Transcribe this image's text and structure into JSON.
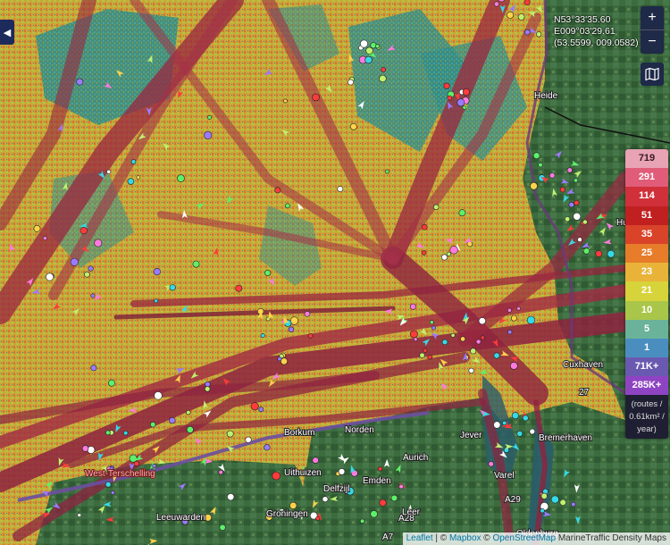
{
  "coords": {
    "lat": "N53°33'35.60",
    "lon": "E009°03'29.61",
    "decimal": "(53.5599, 009.0582)"
  },
  "controls": {
    "zoom_in": "+",
    "zoom_out": "−",
    "side_toggle": "◀",
    "layers_icon": "map-layers-icon"
  },
  "legend": {
    "values": [
      "719",
      "291",
      "114",
      "51",
      "35",
      "25",
      "23",
      "21",
      "10",
      "5",
      "1",
      "71K+",
      "285K+"
    ],
    "colors": [
      "#e8a3b4",
      "#e05c78",
      "#d0303a",
      "#c12020",
      "#d8432a",
      "#e77c2a",
      "#e9b33a",
      "#d7d33a",
      "#a9c64a",
      "#6ab29a",
      "#4a8ec0",
      "#6a59b0",
      "#8e44c2"
    ],
    "unit_lines": [
      "(routes /",
      "0.61km² /",
      "year)"
    ]
  },
  "places": [
    {
      "name": "West-Terschelling",
      "style": "red"
    },
    {
      "name": "Leeuwarden",
      "style": "white"
    },
    {
      "name": "Groningen",
      "style": "white"
    },
    {
      "name": "Uithuizen",
      "style": "white"
    },
    {
      "name": "Emden",
      "style": "white"
    },
    {
      "name": "Aurich",
      "style": "white"
    },
    {
      "name": "Jever",
      "style": "white"
    },
    {
      "name": "Varel",
      "style": "white"
    },
    {
      "name": "Borkum",
      "style": "white"
    },
    {
      "name": "Delfzijl",
      "style": "white"
    },
    {
      "name": "Norden",
      "style": "white"
    },
    {
      "name": "Bremerhaven",
      "style": "white"
    },
    {
      "name": "Cuxhaven",
      "style": "white"
    },
    {
      "name": "Oldenburg",
      "style": "white"
    },
    {
      "name": "A7",
      "style": "white"
    },
    {
      "name": "A28",
      "style": "white"
    },
    {
      "name": "A29",
      "style": "white"
    },
    {
      "name": "27",
      "style": "white"
    },
    {
      "name": "Leer",
      "style": "white"
    },
    {
      "name": "Husum",
      "style": "white"
    },
    {
      "name": "Heide",
      "style": "white"
    }
  ],
  "attribution": {
    "leaflet": "Leaflet",
    "sep1": " | © ",
    "mapbox": "Mapbox",
    "sep2": " © ",
    "osm": "OpenStreetMap",
    "tail": " MarineTraffic Density Maps"
  }
}
